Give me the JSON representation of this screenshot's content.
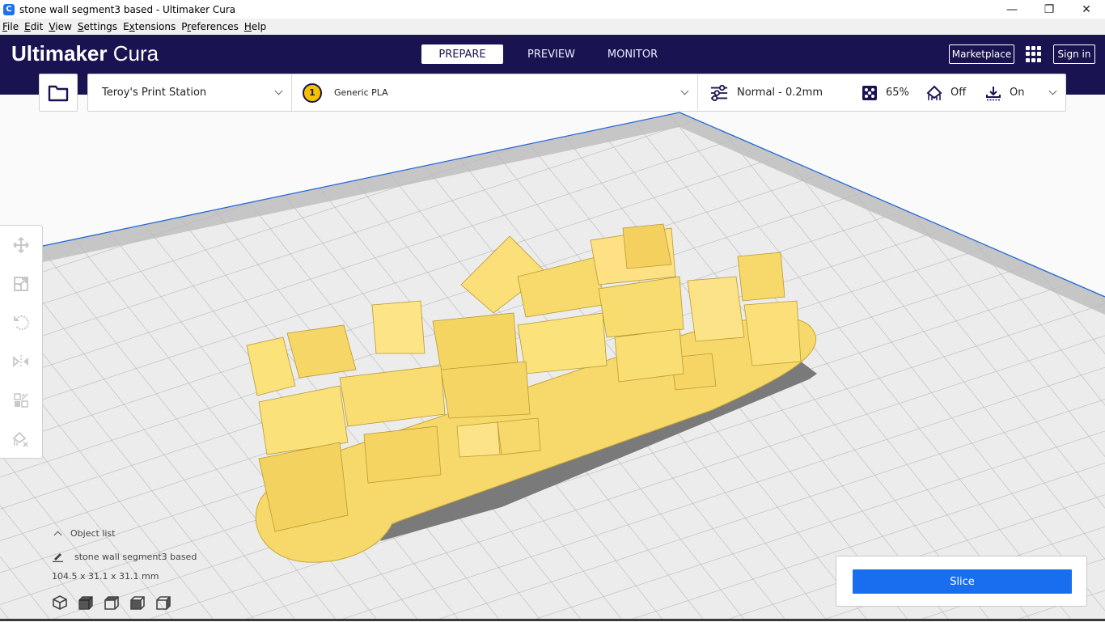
{
  "window": {
    "title": "stone wall segment3 based - Ultimaker Cura",
    "controls": {
      "minimize": "—",
      "restore": "❐",
      "close": "✕"
    }
  },
  "menubar": {
    "items": [
      {
        "label": "File",
        "mnemonic": "F",
        "rest": "ile"
      },
      {
        "label": "Edit",
        "mnemonic": "E",
        "rest": "dit"
      },
      {
        "label": "View",
        "mnemonic": "V",
        "rest": "iew"
      },
      {
        "label": "Settings",
        "mnemonic": "S",
        "rest": "ettings"
      },
      {
        "label": "Extensions",
        "prefix": "E",
        "mnemonic": "x",
        "rest": "tensions"
      },
      {
        "label": "Preferences",
        "prefix": "P",
        "mnemonic": "r",
        "rest": "eferences"
      },
      {
        "label": "Help",
        "mnemonic": "H",
        "rest": "elp"
      }
    ]
  },
  "header": {
    "logo_bold": "Ultimaker",
    "logo_light": "Cura",
    "stages": [
      {
        "label": "PREPARE",
        "active": true
      },
      {
        "label": "PREVIEW",
        "active": false
      },
      {
        "label": "MONITOR",
        "active": false
      }
    ],
    "marketplace_label": "Marketplace",
    "signin_label": "Sign in"
  },
  "toolbar": {
    "printer": "Teroy's Print Station",
    "extruder_number": "1",
    "material": "Generic PLA",
    "profile": "Normal - 0.2mm",
    "infill": "65%",
    "support": "Off",
    "adhesion": "On"
  },
  "tools": [
    {
      "name": "move-tool",
      "icon": "move-icon"
    },
    {
      "name": "scale-tool",
      "icon": "scale-icon"
    },
    {
      "name": "rotate-tool",
      "icon": "rotate-icon"
    },
    {
      "name": "mirror-tool",
      "icon": "mirror-icon"
    },
    {
      "name": "per-model-settings-tool",
      "icon": "per-model-settings-icon"
    },
    {
      "name": "support-blocker-tool",
      "icon": "support-blocker-icon"
    }
  ],
  "object_list": {
    "header": "Object list",
    "object_name": "stone wall segment3 based",
    "dimensions": "104.5 x 31.1 x 31.1 mm",
    "view_buttons": [
      "3d-view",
      "front-view",
      "top-view",
      "left-view",
      "right-view"
    ]
  },
  "slice": {
    "label": "Slice"
  },
  "colors": {
    "header_bg": "#191451",
    "accent_blue": "#196ef0",
    "model_yellow": "#f8dc6a",
    "build_plate": "#e8e8e8"
  }
}
